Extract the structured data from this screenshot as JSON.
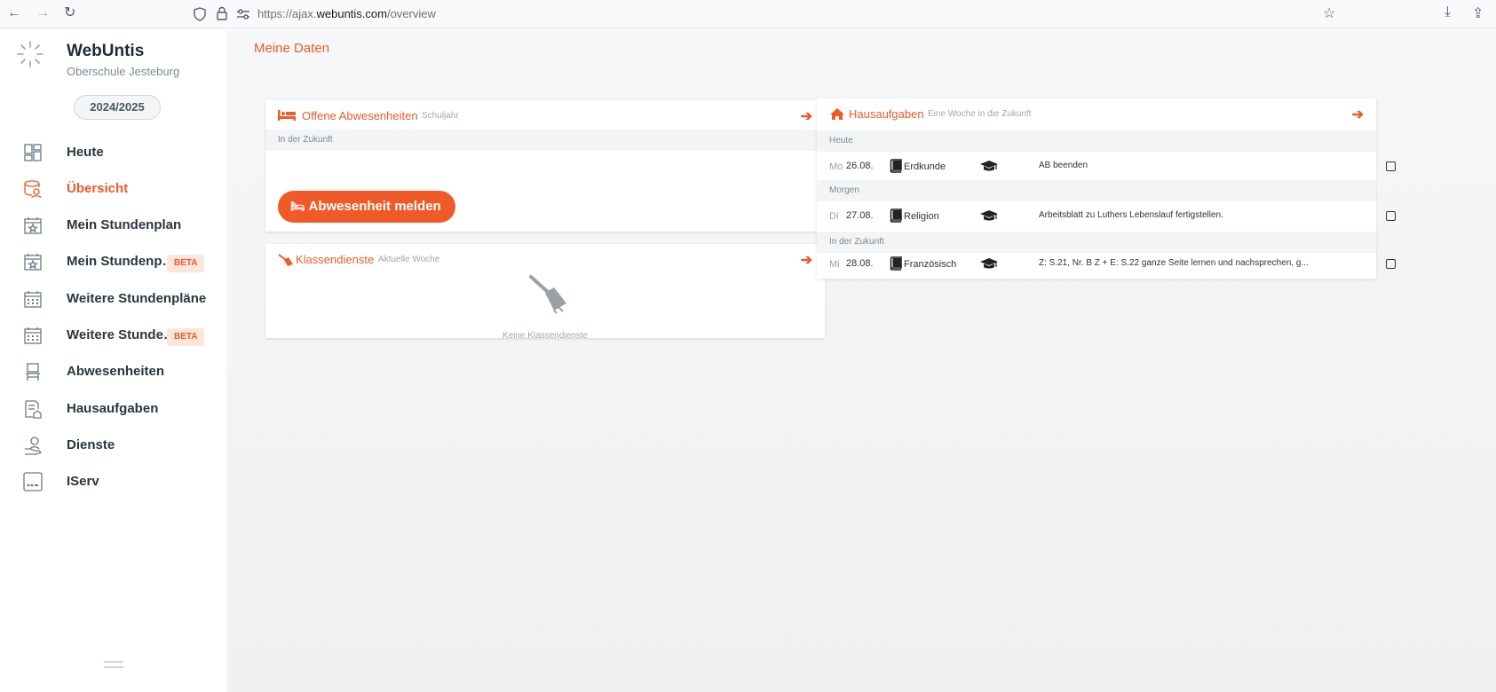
{
  "browser": {
    "url_prefix": "https://ajax.",
    "url_domain": "webuntis.com",
    "url_path": "/overview"
  },
  "sidebar": {
    "brand_title": "WebUntis",
    "brand_subtitle": "Oberschule Jesteburg",
    "school_year": "2024/2025",
    "items": [
      {
        "label": "Heute",
        "icon": "dashboard-icon"
      },
      {
        "label": "Übersicht",
        "icon": "overview-icon",
        "active": true
      },
      {
        "label": "Mein Stundenplan",
        "icon": "calendar-star-icon"
      },
      {
        "label": "Mein Stundenp…",
        "icon": "calendar-star-icon",
        "badge": "BETA"
      },
      {
        "label": "Weitere Stundenpläne",
        "icon": "calendar-grid-icon"
      },
      {
        "label": "Weitere Stunde…",
        "icon": "calendar-grid-icon",
        "badge": "BETA"
      },
      {
        "label": "Abwesenheiten",
        "icon": "chair-icon"
      },
      {
        "label": "Hausaufgaben",
        "icon": "homework-icon"
      },
      {
        "label": "Dienste",
        "icon": "service-icon"
      },
      {
        "label": "IServ",
        "icon": "iserv-icon"
      }
    ]
  },
  "main": {
    "page_title": "Meine Daten",
    "absences_card": {
      "title": "Offene Abwesenheiten",
      "subtitle": "Schuljahr",
      "section": "In der Zukunft",
      "button_label": "Abwesenheit melden"
    },
    "duties_card": {
      "title": "Klassendienste",
      "subtitle": "Aktuelle Woche",
      "empty_text": "Keine Klassendienste"
    },
    "homework_card": {
      "title": "Hausaufgaben",
      "subtitle": "Eine Woche in die Zukunft",
      "sections": [
        "Heute",
        "Morgen",
        "In der Zukunft"
      ],
      "rows": [
        {
          "day": "Mo",
          "date": "26.08.",
          "subject": "Erdkunde",
          "text": "AB beenden"
        },
        {
          "day": "Di",
          "date": "27.08.",
          "subject": "Religion",
          "text": "Arbeitsblatt zu Luthers Lebenslauf fertigstellen."
        },
        {
          "day": "Mi",
          "date": "28.08.",
          "subject": "Französisch",
          "text": "Z: S.21, Nr. B Z + E: S.22 ganze Seite lernen und nachsprechen, g..."
        }
      ]
    }
  },
  "colors": {
    "accent": "#f05a28",
    "text_dark": "#2a3640",
    "muted": "#a0a8ae"
  }
}
